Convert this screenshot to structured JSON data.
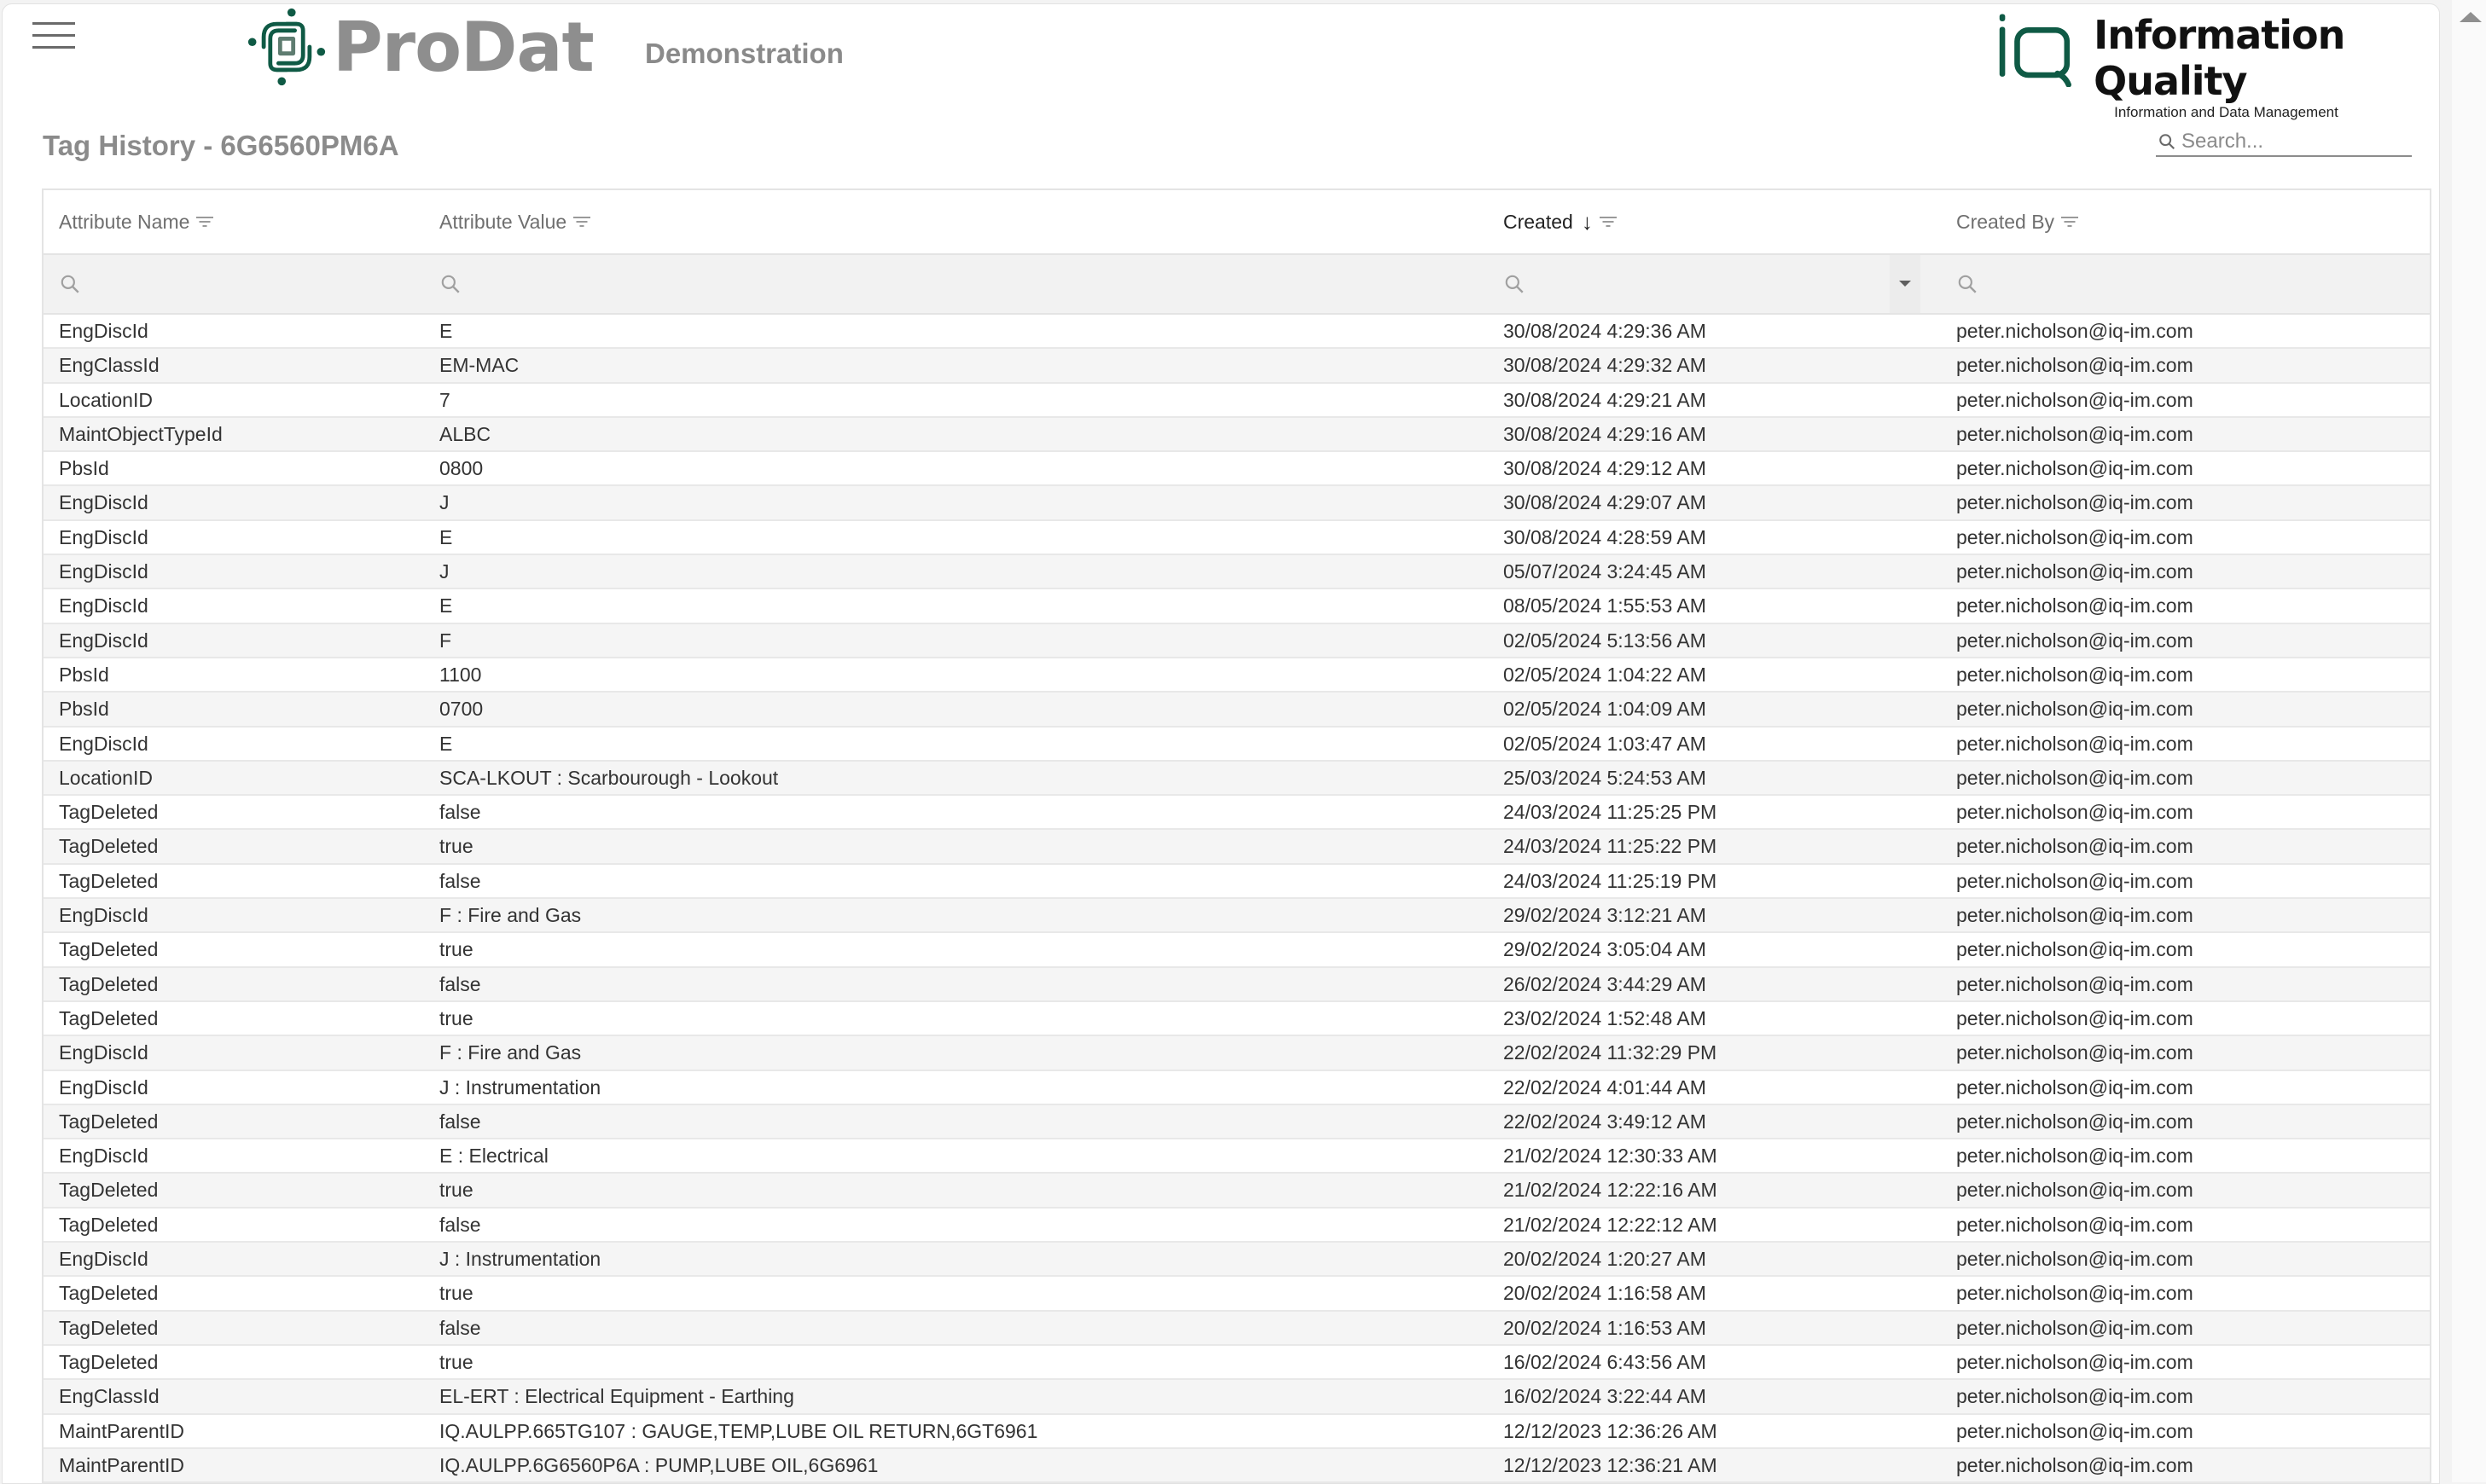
{
  "header": {
    "menu_icon": "hamburger-icon",
    "app_name": "ProDat",
    "environment": "Demonstration",
    "company_name": "Information Quality",
    "company_tagline": "Information and Data Management",
    "brand_color": "#0f5a45"
  },
  "page": {
    "title": "Tag History - 6G6560PM6A",
    "search_placeholder": "Search..."
  },
  "table": {
    "columns": [
      {
        "label": "Attribute Name",
        "sorted": false
      },
      {
        "label": "Attribute Value",
        "sorted": false
      },
      {
        "label": "Created",
        "sorted": true,
        "sort_direction": "descending",
        "sort_icon": "↓"
      },
      {
        "label": "Created By",
        "sorted": false
      }
    ],
    "rows": [
      [
        "EngDiscId",
        "E",
        "30/08/2024 4:29:36 AM",
        "peter.nicholson@iq-im.com"
      ],
      [
        "EngClassId",
        "EM-MAC",
        "30/08/2024 4:29:32 AM",
        "peter.nicholson@iq-im.com"
      ],
      [
        "LocationID",
        "7",
        "30/08/2024 4:29:21 AM",
        "peter.nicholson@iq-im.com"
      ],
      [
        "MaintObjectTypeId",
        "ALBC",
        "30/08/2024 4:29:16 AM",
        "peter.nicholson@iq-im.com"
      ],
      [
        "PbsId",
        "0800",
        "30/08/2024 4:29:12 AM",
        "peter.nicholson@iq-im.com"
      ],
      [
        "EngDiscId",
        "J",
        "30/08/2024 4:29:07 AM",
        "peter.nicholson@iq-im.com"
      ],
      [
        "EngDiscId",
        "E",
        "30/08/2024 4:28:59 AM",
        "peter.nicholson@iq-im.com"
      ],
      [
        "EngDiscId",
        "J",
        "05/07/2024 3:24:45 AM",
        "peter.nicholson@iq-im.com"
      ],
      [
        "EngDiscId",
        "E",
        "08/05/2024 1:55:53 AM",
        "peter.nicholson@iq-im.com"
      ],
      [
        "EngDiscId",
        "F",
        "02/05/2024 5:13:56 AM",
        "peter.nicholson@iq-im.com"
      ],
      [
        "PbsId",
        "1100",
        "02/05/2024 1:04:22 AM",
        "peter.nicholson@iq-im.com"
      ],
      [
        "PbsId",
        "0700",
        "02/05/2024 1:04:09 AM",
        "peter.nicholson@iq-im.com"
      ],
      [
        "EngDiscId",
        "E",
        "02/05/2024 1:03:47 AM",
        "peter.nicholson@iq-im.com"
      ],
      [
        "LocationID",
        "SCA-LKOUT : Scarbourough - Lookout",
        "25/03/2024 5:24:53 AM",
        "peter.nicholson@iq-im.com"
      ],
      [
        "TagDeleted",
        "false",
        "24/03/2024 11:25:25 PM",
        "peter.nicholson@iq-im.com"
      ],
      [
        "TagDeleted",
        "true",
        "24/03/2024 11:25:22 PM",
        "peter.nicholson@iq-im.com"
      ],
      [
        "TagDeleted",
        "false",
        "24/03/2024 11:25:19 PM",
        "peter.nicholson@iq-im.com"
      ],
      [
        "EngDiscId",
        "F : Fire and Gas",
        "29/02/2024 3:12:21 AM",
        "peter.nicholson@iq-im.com"
      ],
      [
        "TagDeleted",
        "true",
        "29/02/2024 3:05:04 AM",
        "peter.nicholson@iq-im.com"
      ],
      [
        "TagDeleted",
        "false",
        "26/02/2024 3:44:29 AM",
        "peter.nicholson@iq-im.com"
      ],
      [
        "TagDeleted",
        "true",
        "23/02/2024 1:52:48 AM",
        "peter.nicholson@iq-im.com"
      ],
      [
        "EngDiscId",
        "F : Fire and Gas",
        "22/02/2024 11:32:29 PM",
        "peter.nicholson@iq-im.com"
      ],
      [
        "EngDiscId",
        "J : Instrumentation",
        "22/02/2024 4:01:44 AM",
        "peter.nicholson@iq-im.com"
      ],
      [
        "TagDeleted",
        "false",
        "22/02/2024 3:49:12 AM",
        "peter.nicholson@iq-im.com"
      ],
      [
        "EngDiscId",
        "E : Electrical",
        "21/02/2024 12:30:33 AM",
        "peter.nicholson@iq-im.com"
      ],
      [
        "TagDeleted",
        "true",
        "21/02/2024 12:22:16 AM",
        "peter.nicholson@iq-im.com"
      ],
      [
        "TagDeleted",
        "false",
        "21/02/2024 12:22:12 AM",
        "peter.nicholson@iq-im.com"
      ],
      [
        "EngDiscId",
        "J : Instrumentation",
        "20/02/2024 1:20:27 AM",
        "peter.nicholson@iq-im.com"
      ],
      [
        "TagDeleted",
        "true",
        "20/02/2024 1:16:58 AM",
        "peter.nicholson@iq-im.com"
      ],
      [
        "TagDeleted",
        "false",
        "20/02/2024 1:16:53 AM",
        "peter.nicholson@iq-im.com"
      ],
      [
        "TagDeleted",
        "true",
        "16/02/2024 6:43:56 AM",
        "peter.nicholson@iq-im.com"
      ],
      [
        "EngClassId",
        "EL-ERT : Electrical Equipment - Earthing",
        "16/02/2024 3:22:44 AM",
        "peter.nicholson@iq-im.com"
      ],
      [
        "MaintParentID",
        "IQ.AULPP.665TG107 : GAUGE,TEMP,LUBE OIL RETURN,6GT6961",
        "12/12/2023 12:36:26 AM",
        "peter.nicholson@iq-im.com"
      ],
      [
        "MaintParentID",
        "IQ.AULPP.6G6560P6A : PUMP,LUBE OIL,6G6961",
        "12/12/2023 12:36:21 AM",
        "peter.nicholson@iq-im.com"
      ]
    ]
  }
}
